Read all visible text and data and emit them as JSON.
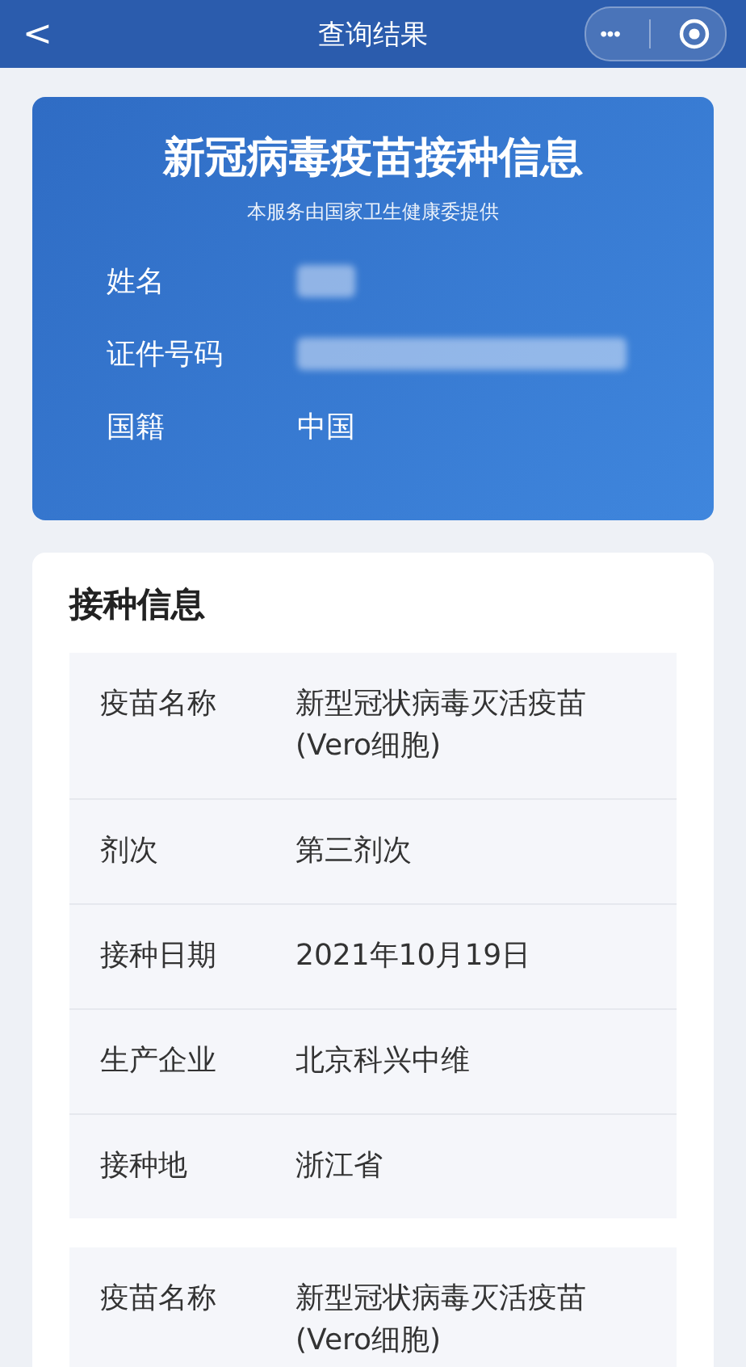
{
  "nav": {
    "back": "<",
    "title": "查询结果",
    "more": "•••"
  },
  "header": {
    "title": "新冠病毒疫苗接种信息",
    "subtitle": "本服务由国家卫生健康委提供",
    "fields": [
      {
        "label": "姓名",
        "kind": "redacted"
      },
      {
        "label": "证件号码",
        "kind": "redacted"
      },
      {
        "label": "国籍",
        "kind": "text",
        "value": "中国"
      }
    ]
  },
  "section": {
    "title": "接种信息",
    "records": [
      {
        "rows": [
          {
            "label": "疫苗名称",
            "value": "新型冠状病毒灭活疫苗(Vero细胞)"
          },
          {
            "label": "剂次",
            "value": "第三剂次"
          },
          {
            "label": "接种日期",
            "value": "2021年10月19日"
          },
          {
            "label": "生产企业",
            "value": "北京科兴中维"
          },
          {
            "label": "接种地",
            "value": "浙江省"
          }
        ]
      },
      {
        "rows": [
          {
            "label": "疫苗名称",
            "value": "新型冠状病毒灭活疫苗(Vero细胞)"
          }
        ]
      }
    ]
  }
}
